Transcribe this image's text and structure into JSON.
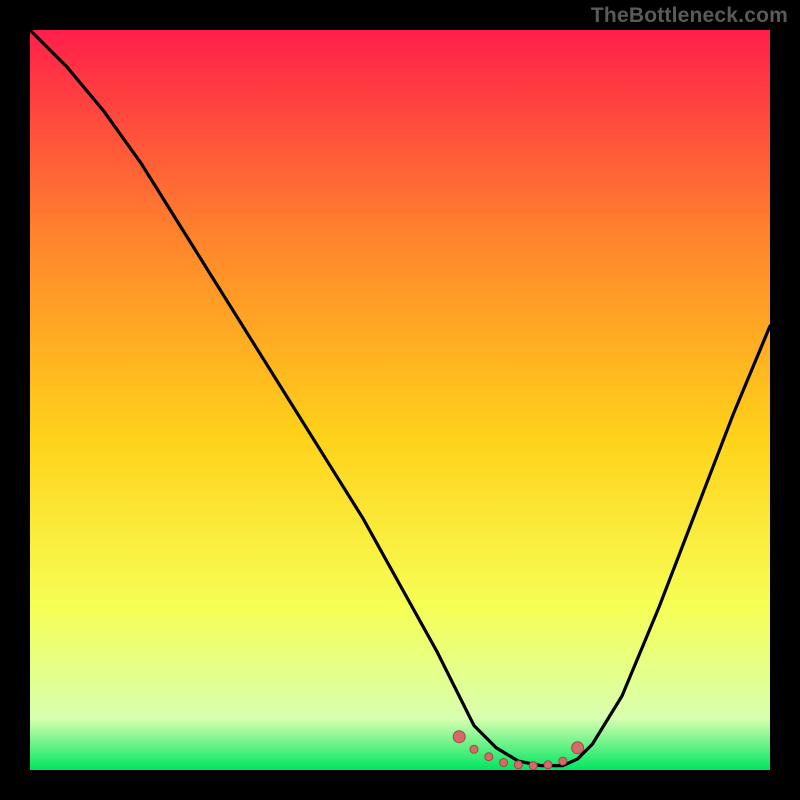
{
  "watermark": "TheBottleneck.com",
  "colors": {
    "bg": "#000000",
    "gradient_top": "#ff1f4a",
    "gradient_upper_mid": "#ff8a2a",
    "gradient_mid": "#ffd21a",
    "gradient_lower_mid": "#f6ff55",
    "gradient_near_bottom": "#d8ffb0",
    "gradient_bottom": "#00e560",
    "curve": "#000000",
    "marker_fill": "#d46a6a",
    "marker_stroke": "#a04646",
    "watermark": "#5a5a5a"
  },
  "chart_data": {
    "type": "line",
    "title": "",
    "xlabel": "",
    "ylabel": "",
    "xlim": [
      0,
      100
    ],
    "ylim": [
      0,
      100
    ],
    "x": [
      0,
      5,
      10,
      15,
      20,
      25,
      30,
      35,
      40,
      45,
      50,
      55,
      58,
      60,
      63,
      66,
      69,
      72,
      74,
      76,
      80,
      85,
      90,
      95,
      100
    ],
    "values": [
      100,
      95,
      89,
      82,
      74,
      66,
      58,
      50,
      42,
      34,
      25,
      16,
      10,
      6,
      3,
      1.2,
      0.6,
      0.6,
      1.5,
      3.5,
      10,
      22,
      35,
      48,
      60
    ],
    "markers": {
      "x": [
        58,
        60,
        62,
        64,
        66,
        68,
        70,
        72,
        74
      ],
      "y": [
        4.5,
        2.8,
        1.8,
        1.0,
        0.7,
        0.6,
        0.7,
        1.2,
        3.0
      ]
    },
    "annotations": []
  }
}
